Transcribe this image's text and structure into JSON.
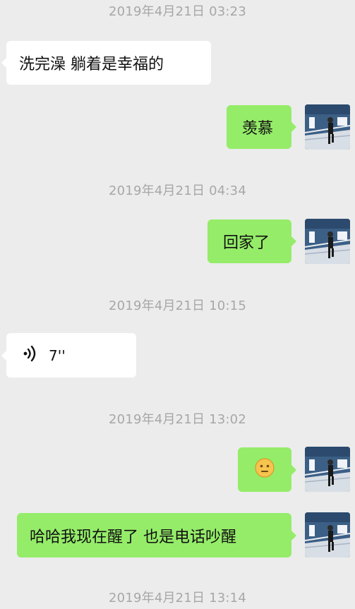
{
  "timestamps": [
    "2019年4月21日 03:23",
    "2019年4月21日 04:34",
    "2019年4月21日 10:15",
    "2019年4月21日 13:02",
    "2019年4月21日 13:14"
  ],
  "messages": {
    "m1": {
      "text": "洗完澡 躺着是幸福的",
      "side": "incoming"
    },
    "m2": {
      "text": "羡慕",
      "side": "outgoing"
    },
    "m3": {
      "text": "回家了",
      "side": "outgoing"
    },
    "m4": {
      "duration": "7''",
      "side": "incoming",
      "type": "voice"
    },
    "m5": {
      "emoji": "neutral-face-emoji",
      "side": "outgoing",
      "type": "emoji"
    },
    "m6": {
      "text": "哈哈我现在醒了 也是电话吵醒",
      "side": "outgoing"
    }
  },
  "colors": {
    "background": "#ececec",
    "incoming_bubble": "#ffffff",
    "outgoing_bubble": "#95ec69",
    "timestamp_text": "#a7a7a7"
  }
}
